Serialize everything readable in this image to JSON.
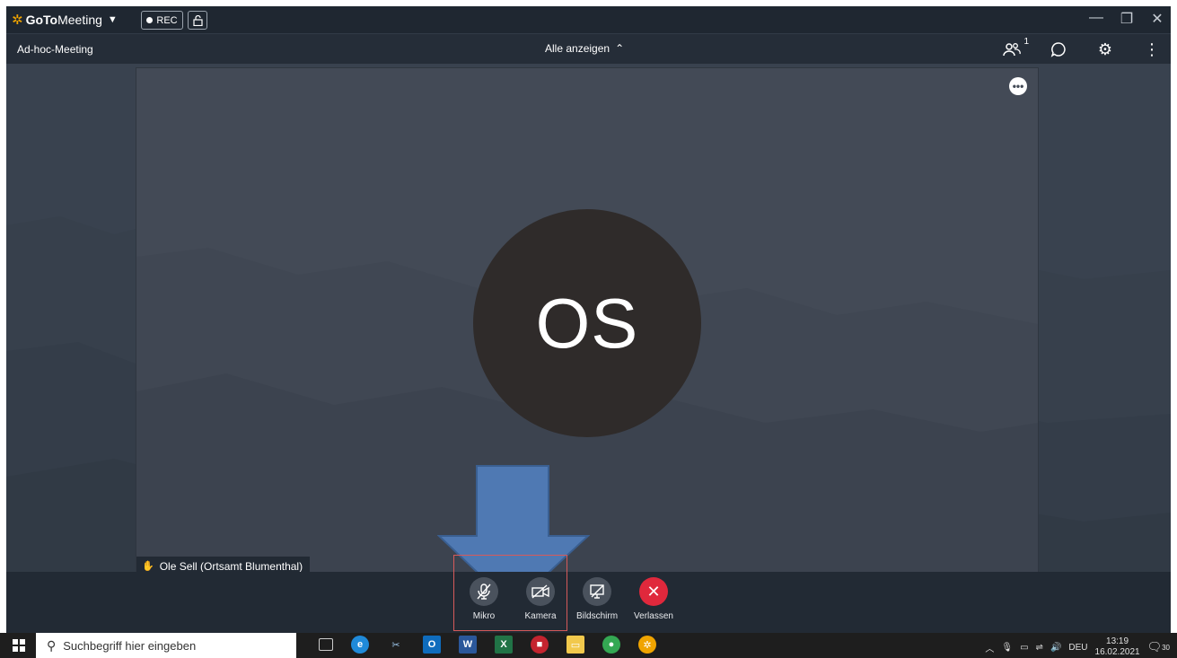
{
  "app": {
    "brand_goto": "GoTo",
    "brand_meeting": "Meeting",
    "rec_label": "REC"
  },
  "menubar": {
    "meeting_name": "Ad-hoc-Meeting",
    "view_select": "Alle anzeigen",
    "participants_count": "1"
  },
  "stage": {
    "avatar_initials": "OS",
    "participant_name": "Ole Sell (Ortsamt Blumenthal)"
  },
  "controls": {
    "mic_label": "Mikro",
    "camera_label": "Kamera",
    "screen_label": "Bildschirm",
    "leave_label": "Verlassen"
  },
  "taskbar": {
    "search_placeholder": "Suchbegriff hier eingeben",
    "language": "DEU",
    "time": "13:19",
    "date": "16.02.2021",
    "notification_count": "30"
  },
  "colors": {
    "accent_orange": "#f0a400",
    "leave_red": "#e0283c",
    "annotation_arrow": "#4f79b3",
    "highlight_box": "#d65a5a"
  }
}
